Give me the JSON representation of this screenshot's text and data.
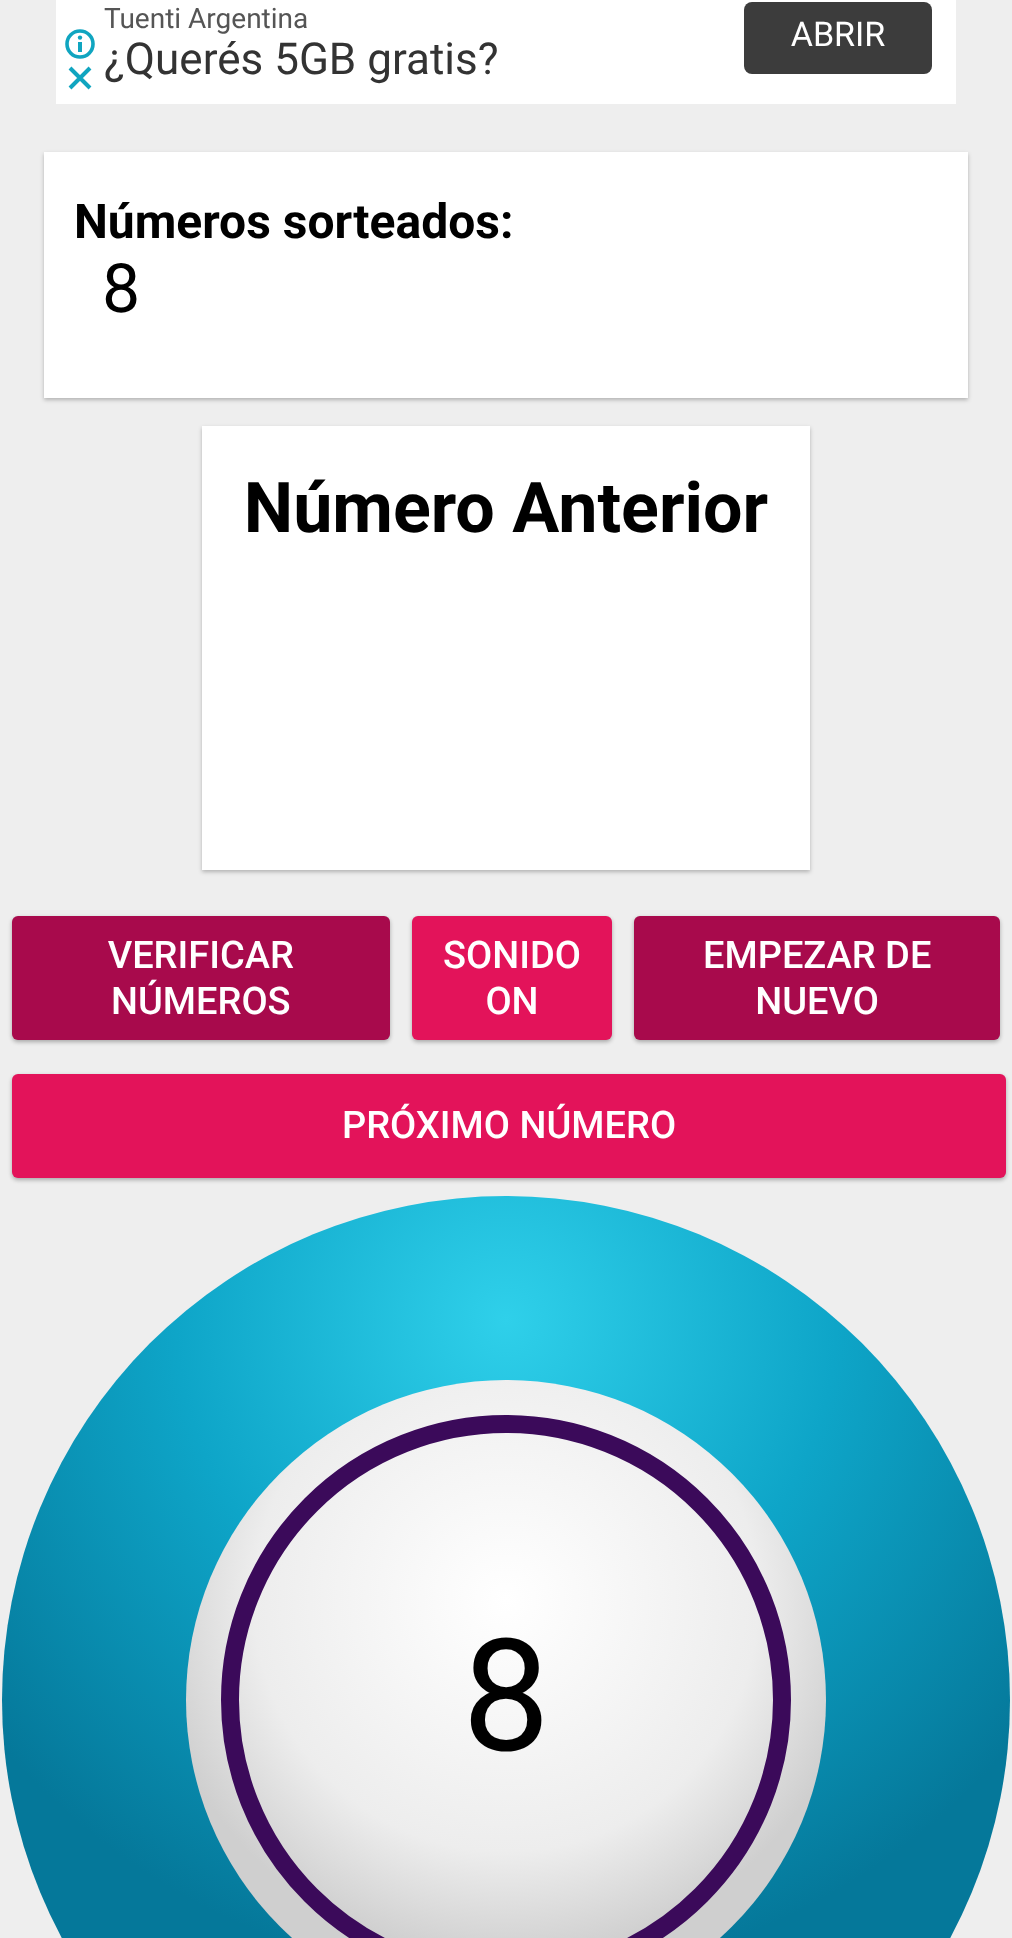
{
  "ad": {
    "advertiser": "Tuenti Argentina",
    "headline": "¿Querés 5GB gratis?",
    "button": "ABRIR"
  },
  "drawn_numbers": {
    "title": "Números sorteados:",
    "numbers": "8"
  },
  "previous_number": {
    "title": "Número Anterior"
  },
  "buttons": [
    {
      "label": "VERIFICAR NÚMEROS",
      "kind": "dark"
    },
    {
      "label": "SONIDO ON",
      "kind": "bright"
    },
    {
      "label": "EMPEZAR DE NUEVO",
      "kind": "dark"
    }
  ],
  "next_button": {
    "label": "PRÓXIMO NÚMERO"
  },
  "ball": {
    "number": "8"
  }
}
